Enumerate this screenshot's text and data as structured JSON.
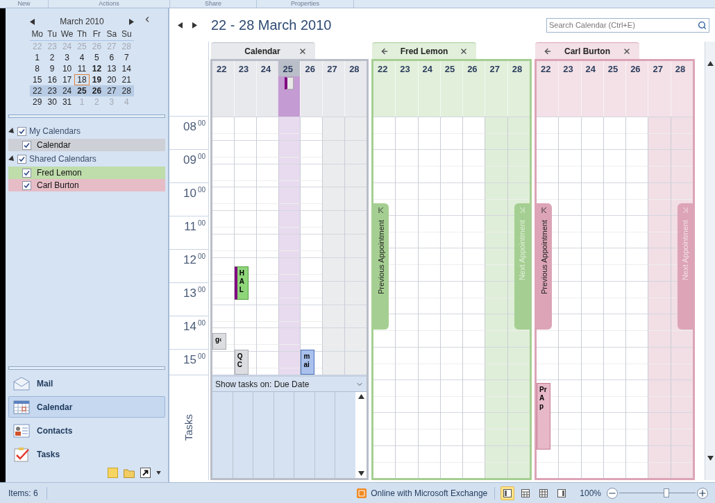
{
  "ribbon_groups": [
    "New",
    "Actions",
    "Share",
    "Properties"
  ],
  "mini_calendar": {
    "month": "March 2010",
    "weekdays": [
      "Mo",
      "Tu",
      "We",
      "Th",
      "Fr",
      "Sa",
      "Su"
    ],
    "weeks": [
      {
        "selected": false,
        "days": [
          {
            "label": "22",
            "muted": true,
            "today": false,
            "bold": false
          },
          {
            "label": "23",
            "muted": true,
            "today": false,
            "bold": false
          },
          {
            "label": "24",
            "muted": true,
            "today": false,
            "bold": false
          },
          {
            "label": "25",
            "muted": true,
            "today": false,
            "bold": false
          },
          {
            "label": "26",
            "muted": true,
            "today": false,
            "bold": false
          },
          {
            "label": "27",
            "muted": true,
            "today": false,
            "bold": false
          },
          {
            "label": "28",
            "muted": true,
            "today": false,
            "bold": false
          }
        ]
      },
      {
        "selected": false,
        "days": [
          {
            "label": "1",
            "muted": false,
            "today": false,
            "bold": false
          },
          {
            "label": "2",
            "muted": false,
            "today": false,
            "bold": false
          },
          {
            "label": "3",
            "muted": false,
            "today": false,
            "bold": false
          },
          {
            "label": "4",
            "muted": false,
            "today": false,
            "bold": false
          },
          {
            "label": "5",
            "muted": false,
            "today": false,
            "bold": false
          },
          {
            "label": "6",
            "muted": false,
            "today": false,
            "bold": false
          },
          {
            "label": "7",
            "muted": false,
            "today": false,
            "bold": false
          }
        ]
      },
      {
        "selected": false,
        "days": [
          {
            "label": "8",
            "muted": false,
            "today": false,
            "bold": false
          },
          {
            "label": "9",
            "muted": false,
            "today": false,
            "bold": false
          },
          {
            "label": "10",
            "muted": false,
            "today": false,
            "bold": false
          },
          {
            "label": "11",
            "muted": false,
            "today": false,
            "bold": false
          },
          {
            "label": "12",
            "muted": false,
            "today": false,
            "bold": true
          },
          {
            "label": "13",
            "muted": false,
            "today": false,
            "bold": false
          },
          {
            "label": "14",
            "muted": false,
            "today": false,
            "bold": false
          }
        ]
      },
      {
        "selected": false,
        "days": [
          {
            "label": "15",
            "muted": false,
            "today": false,
            "bold": false
          },
          {
            "label": "16",
            "muted": false,
            "today": false,
            "bold": false
          },
          {
            "label": "17",
            "muted": false,
            "today": false,
            "bold": false
          },
          {
            "label": "18",
            "muted": false,
            "today": true,
            "bold": false
          },
          {
            "label": "19",
            "muted": false,
            "today": false,
            "bold": true
          },
          {
            "label": "20",
            "muted": false,
            "today": false,
            "bold": false
          },
          {
            "label": "21",
            "muted": false,
            "today": false,
            "bold": false
          }
        ]
      },
      {
        "selected": true,
        "days": [
          {
            "label": "22",
            "muted": false,
            "today": false,
            "bold": false
          },
          {
            "label": "23",
            "muted": false,
            "today": false,
            "bold": false
          },
          {
            "label": "24",
            "muted": false,
            "today": false,
            "bold": false
          },
          {
            "label": "25",
            "muted": false,
            "today": false,
            "bold": true
          },
          {
            "label": "26",
            "muted": false,
            "today": false,
            "bold": true
          },
          {
            "label": "27",
            "muted": false,
            "today": false,
            "bold": false
          },
          {
            "label": "28",
            "muted": false,
            "today": false,
            "bold": false
          }
        ]
      },
      {
        "selected": false,
        "days": [
          {
            "label": "29",
            "muted": false,
            "today": false,
            "bold": false
          },
          {
            "label": "30",
            "muted": false,
            "today": false,
            "bold": false
          },
          {
            "label": "31",
            "muted": false,
            "today": false,
            "bold": false
          },
          {
            "label": "1",
            "muted": true,
            "today": false,
            "bold": false
          },
          {
            "label": "2",
            "muted": true,
            "today": false,
            "bold": false
          },
          {
            "label": "3",
            "muted": true,
            "today": false,
            "bold": false
          },
          {
            "label": "4",
            "muted": true,
            "today": false,
            "bold": false
          }
        ]
      }
    ]
  },
  "folder_tree": [
    {
      "label": "My Calendars",
      "checked": true,
      "expanded": true,
      "children": [
        {
          "label": "Calendar",
          "checked": true,
          "color": "#cdd0d6"
        }
      ]
    },
    {
      "label": "Shared Calendars",
      "checked": true,
      "expanded": true,
      "children": [
        {
          "label": "Fred Lemon",
          "checked": true,
          "color": "#bfdcab"
        },
        {
          "label": "Carl Burton",
          "checked": true,
          "color": "#e6bdc7"
        }
      ]
    }
  ],
  "nav_buttons": [
    {
      "label": "Mail",
      "kind": "mail",
      "selected": false
    },
    {
      "label": "Calendar",
      "kind": "calendar",
      "selected": true
    },
    {
      "label": "Contacts",
      "kind": "contacts",
      "selected": false
    },
    {
      "label": "Tasks",
      "kind": "tasks",
      "selected": false
    }
  ],
  "shortcuts": [
    {
      "kind": "note"
    },
    {
      "kind": "folder"
    },
    {
      "kind": "shortcut"
    }
  ],
  "header": {
    "title": "22 - 28 March 2010",
    "search": {
      "placeholder": "Search Calendar (Ctrl+E)"
    }
  },
  "hours": [
    {
      "hour": "08",
      "minutes": "00"
    },
    {
      "hour": "09",
      "minutes": "00"
    },
    {
      "hour": "10",
      "minutes": "00"
    },
    {
      "hour": "11",
      "minutes": "00"
    },
    {
      "hour": "12",
      "minutes": "00"
    },
    {
      "hour": "13",
      "minutes": "00"
    },
    {
      "hour": "14",
      "minutes": "00"
    },
    {
      "hour": "15",
      "minutes": "00"
    }
  ],
  "calendars": [
    {
      "name": "Calendar",
      "kind": "own",
      "color": "#b9bec8",
      "days": [
        {
          "label": "22",
          "weekend": false,
          "highlighted": false,
          "all_day": false
        },
        {
          "label": "23",
          "weekend": false,
          "highlighted": false,
          "all_day": false
        },
        {
          "label": "24",
          "weekend": false,
          "highlighted": false,
          "all_day": false
        },
        {
          "label": "25",
          "weekend": false,
          "highlighted": true,
          "all_day": true
        },
        {
          "label": "26",
          "weekend": false,
          "highlighted": false,
          "all_day": false
        },
        {
          "label": "27",
          "weekend": true,
          "highlighted": false,
          "all_day": false
        },
        {
          "label": "28",
          "weekend": true,
          "highlighted": false,
          "all_day": false
        }
      ],
      "appointments": [
        {
          "text": "H A L",
          "kind": "green"
        },
        {
          "text": "g‹",
          "kind": "gray"
        },
        {
          "text": "Q C",
          "kind": "gray"
        },
        {
          "text": "m ai",
          "kind": "blue"
        }
      ],
      "tasks": {
        "label": "Tasks",
        "show_on": "Show tasks on: Due Date"
      }
    },
    {
      "name": "Fred Lemon",
      "kind": "shared",
      "color": "#a5cf92",
      "days": [
        {
          "label": "22",
          "weekend": false,
          "highlighted": false,
          "all_day": false
        },
        {
          "label": "23",
          "weekend": false,
          "highlighted": false,
          "all_day": false
        },
        {
          "label": "24",
          "weekend": false,
          "highlighted": false,
          "all_day": false
        },
        {
          "label": "25",
          "weekend": false,
          "highlighted": false,
          "all_day": false
        },
        {
          "label": "26",
          "weekend": false,
          "highlighted": false,
          "all_day": false
        },
        {
          "label": "27",
          "weekend": true,
          "highlighted": false,
          "all_day": false
        },
        {
          "label": "28",
          "weekend": true,
          "highlighted": false,
          "all_day": false
        }
      ],
      "previous": {
        "label": "Previous Appointment",
        "disabled": false
      },
      "next": {
        "label": "Next Appointment",
        "disabled": true
      }
    },
    {
      "name": "Carl Burton",
      "kind": "shared",
      "color": "#dca4b6",
      "days": [
        {
          "label": "22",
          "weekend": false,
          "highlighted": false,
          "all_day": false
        },
        {
          "label": "23",
          "weekend": false,
          "highlighted": false,
          "all_day": false
        },
        {
          "label": "24",
          "weekend": false,
          "highlighted": false,
          "all_day": false
        },
        {
          "label": "25",
          "weekend": false,
          "highlighted": false,
          "all_day": false
        },
        {
          "label": "26",
          "weekend": false,
          "highlighted": false,
          "all_day": false
        },
        {
          "label": "27",
          "weekend": true,
          "highlighted": false,
          "all_day": false
        },
        {
          "label": "28",
          "weekend": true,
          "highlighted": false,
          "all_day": false
        }
      ],
      "appointments": [
        {
          "text": "Pr Ap",
          "kind": "pink"
        }
      ],
      "previous": {
        "label": "Previous Appointment",
        "disabled": false
      },
      "next": {
        "label": "Next Appointment",
        "disabled": true
      }
    }
  ],
  "status_bar": {
    "items": "Items: 6",
    "connection": "Online with Microsoft Exchange",
    "views": [
      {
        "kind": "normal",
        "selected": true
      },
      {
        "kind": "reading",
        "selected": false
      },
      {
        "kind": "grid",
        "selected": false
      },
      {
        "kind": "single",
        "selected": false
      }
    ],
    "zoom": "100%",
    "level": 0.62
  }
}
